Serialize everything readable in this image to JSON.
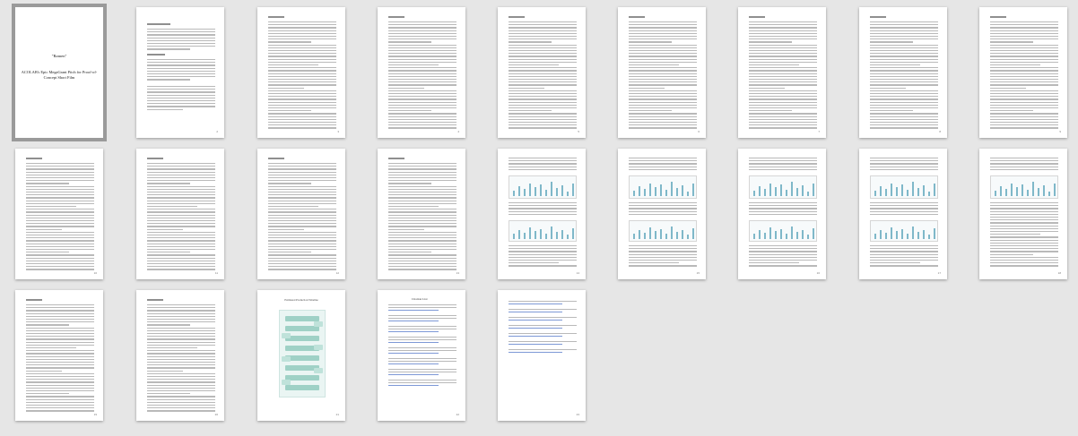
{
  "document": {
    "cover_title": "\"Ramen\"",
    "cover_subtitle": "ACOLAB's Epic MegaGrant Pitch for Proof-of-Concept Short Film",
    "infographic_title": "Estimated Production Timeline",
    "bibliography_heading": "Citation List"
  },
  "pages": [
    {
      "label": "1"
    },
    {
      "label": "2"
    },
    {
      "label": "3"
    },
    {
      "label": "4"
    },
    {
      "label": "5"
    },
    {
      "label": "6"
    },
    {
      "label": "7"
    },
    {
      "label": "8"
    },
    {
      "label": "9"
    },
    {
      "label": "10"
    },
    {
      "label": "11"
    },
    {
      "label": "12"
    },
    {
      "label": "13"
    },
    {
      "label": "14"
    },
    {
      "label": "15"
    },
    {
      "label": "16"
    },
    {
      "label": "17"
    },
    {
      "label": "18"
    },
    {
      "label": "19"
    },
    {
      "label": "20"
    },
    {
      "label": "21"
    },
    {
      "label": "22"
    },
    {
      "label": "23"
    }
  ],
  "selected_page": 1
}
